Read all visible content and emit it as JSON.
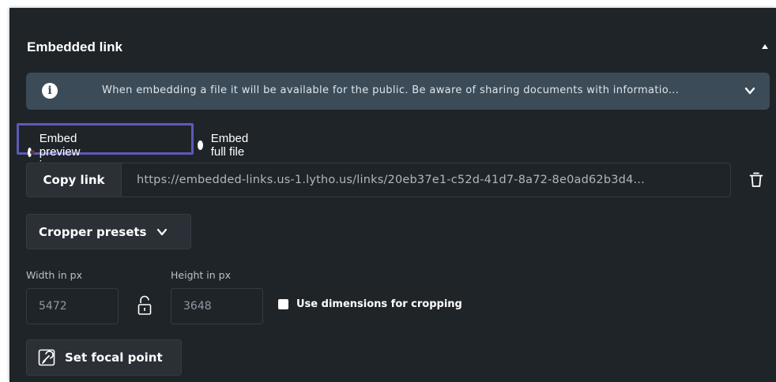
{
  "section": {
    "title": "Embedded link"
  },
  "info_banner": {
    "text": "When embedding a file it will be available for the public. Be aware of sharing documents with informatio...",
    "icon": "info-icon"
  },
  "embed_options": {
    "selected": "Embed preview image",
    "options": [
      {
        "label": "Embed preview image",
        "checked": true
      },
      {
        "label": "Embed full file",
        "checked": false
      }
    ]
  },
  "link": {
    "copy_label": "Copy link",
    "url": "https://embedded-links.us-1.lytho.us/links/20eb37e1-c52d-41d7-8a72-8e0ad62b3d4..."
  },
  "cropper": {
    "label": "Cropper presets"
  },
  "dimensions": {
    "width_label": "Width in px",
    "height_label": "Height in px",
    "width_value": "5472",
    "height_value": "3648",
    "use_for_cropping_label": "Use dimensions for cropping",
    "use_for_cropping_checked": false
  },
  "focal": {
    "label": "Set focal point"
  },
  "colors": {
    "panel_bg": "#1f2428",
    "banner_bg": "#3b4b57",
    "highlight": "#5d5ab8"
  }
}
